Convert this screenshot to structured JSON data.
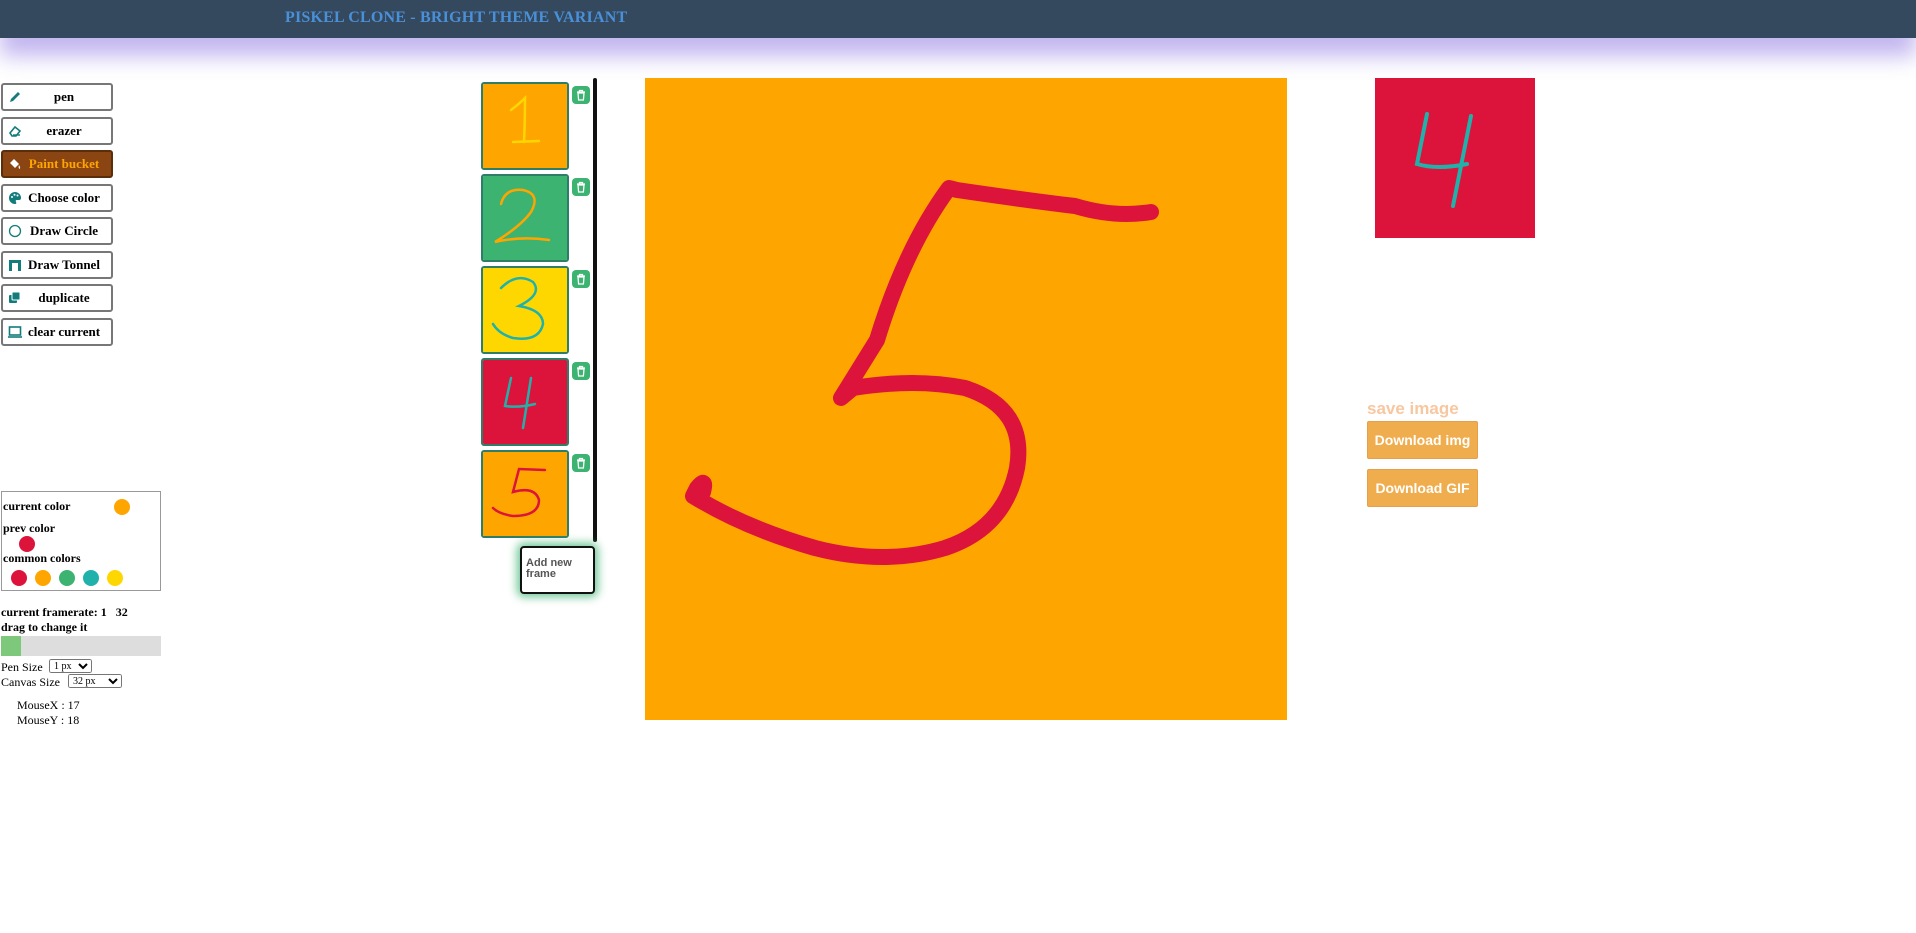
{
  "app": {
    "title": "PISKEL CLONE - BRIGHT THEME VARIANT"
  },
  "tools": [
    {
      "label": "pen",
      "icon": "pen-icon",
      "active": false
    },
    {
      "label": "erazer",
      "icon": "eraser-icon",
      "active": false
    },
    {
      "label": "Paint bucket",
      "icon": "paint-bucket-icon",
      "active": true
    },
    {
      "label": "Choose color",
      "icon": "palette-icon",
      "active": false
    },
    {
      "label": "Draw Circle",
      "icon": "circle-icon",
      "active": false
    },
    {
      "label": "Draw Tonnel",
      "icon": "tunnel-icon",
      "active": false
    },
    {
      "label": "duplicate",
      "icon": "duplicate-icon",
      "active": false
    },
    {
      "label": "clear current",
      "icon": "monitor-icon",
      "active": false
    }
  ],
  "palette": {
    "current_label": "current color",
    "current_color": "#ffa500",
    "prev_label": "prev color",
    "prev_color": "#dc143c",
    "common_label": "common colors",
    "common_colors": [
      "#dc143c",
      "#ffa500",
      "#3cb371",
      "#20b2aa",
      "#ffd700"
    ]
  },
  "framerate": {
    "label": "current framerate: ",
    "value": "1",
    "max": "32",
    "hint": "drag to change it"
  },
  "pen_size": {
    "label": "Pen Size",
    "selected": "1 px"
  },
  "canvas_size": {
    "label": "Canvas Size",
    "selected": "32 px"
  },
  "mouse": {
    "x_text": "MouseX : 17",
    "y_text": "MouseY : 18"
  },
  "frames": [
    {
      "digit": "1",
      "bg": "#ffa500",
      "stroke": "#ffd700"
    },
    {
      "digit": "2",
      "bg": "#3cb371",
      "stroke": "#ffa500"
    },
    {
      "digit": "3",
      "bg": "#ffd700",
      "stroke": "#20b2aa"
    },
    {
      "digit": "4",
      "bg": "#dc143c",
      "stroke": "#20b2aa"
    },
    {
      "digit": "5",
      "bg": "#ffa500",
      "stroke": "#dc143c"
    }
  ],
  "add_frame_label": "Add new frame",
  "canvas": {
    "bg": "#ffa500",
    "stroke": "#dc143c",
    "digit": "5"
  },
  "preview": {
    "bg": "#dc143c",
    "stroke": "#20b2aa",
    "digit": "4"
  },
  "save": {
    "title": "save image",
    "download_img": "Download img",
    "download_gif": "Download GIF"
  }
}
